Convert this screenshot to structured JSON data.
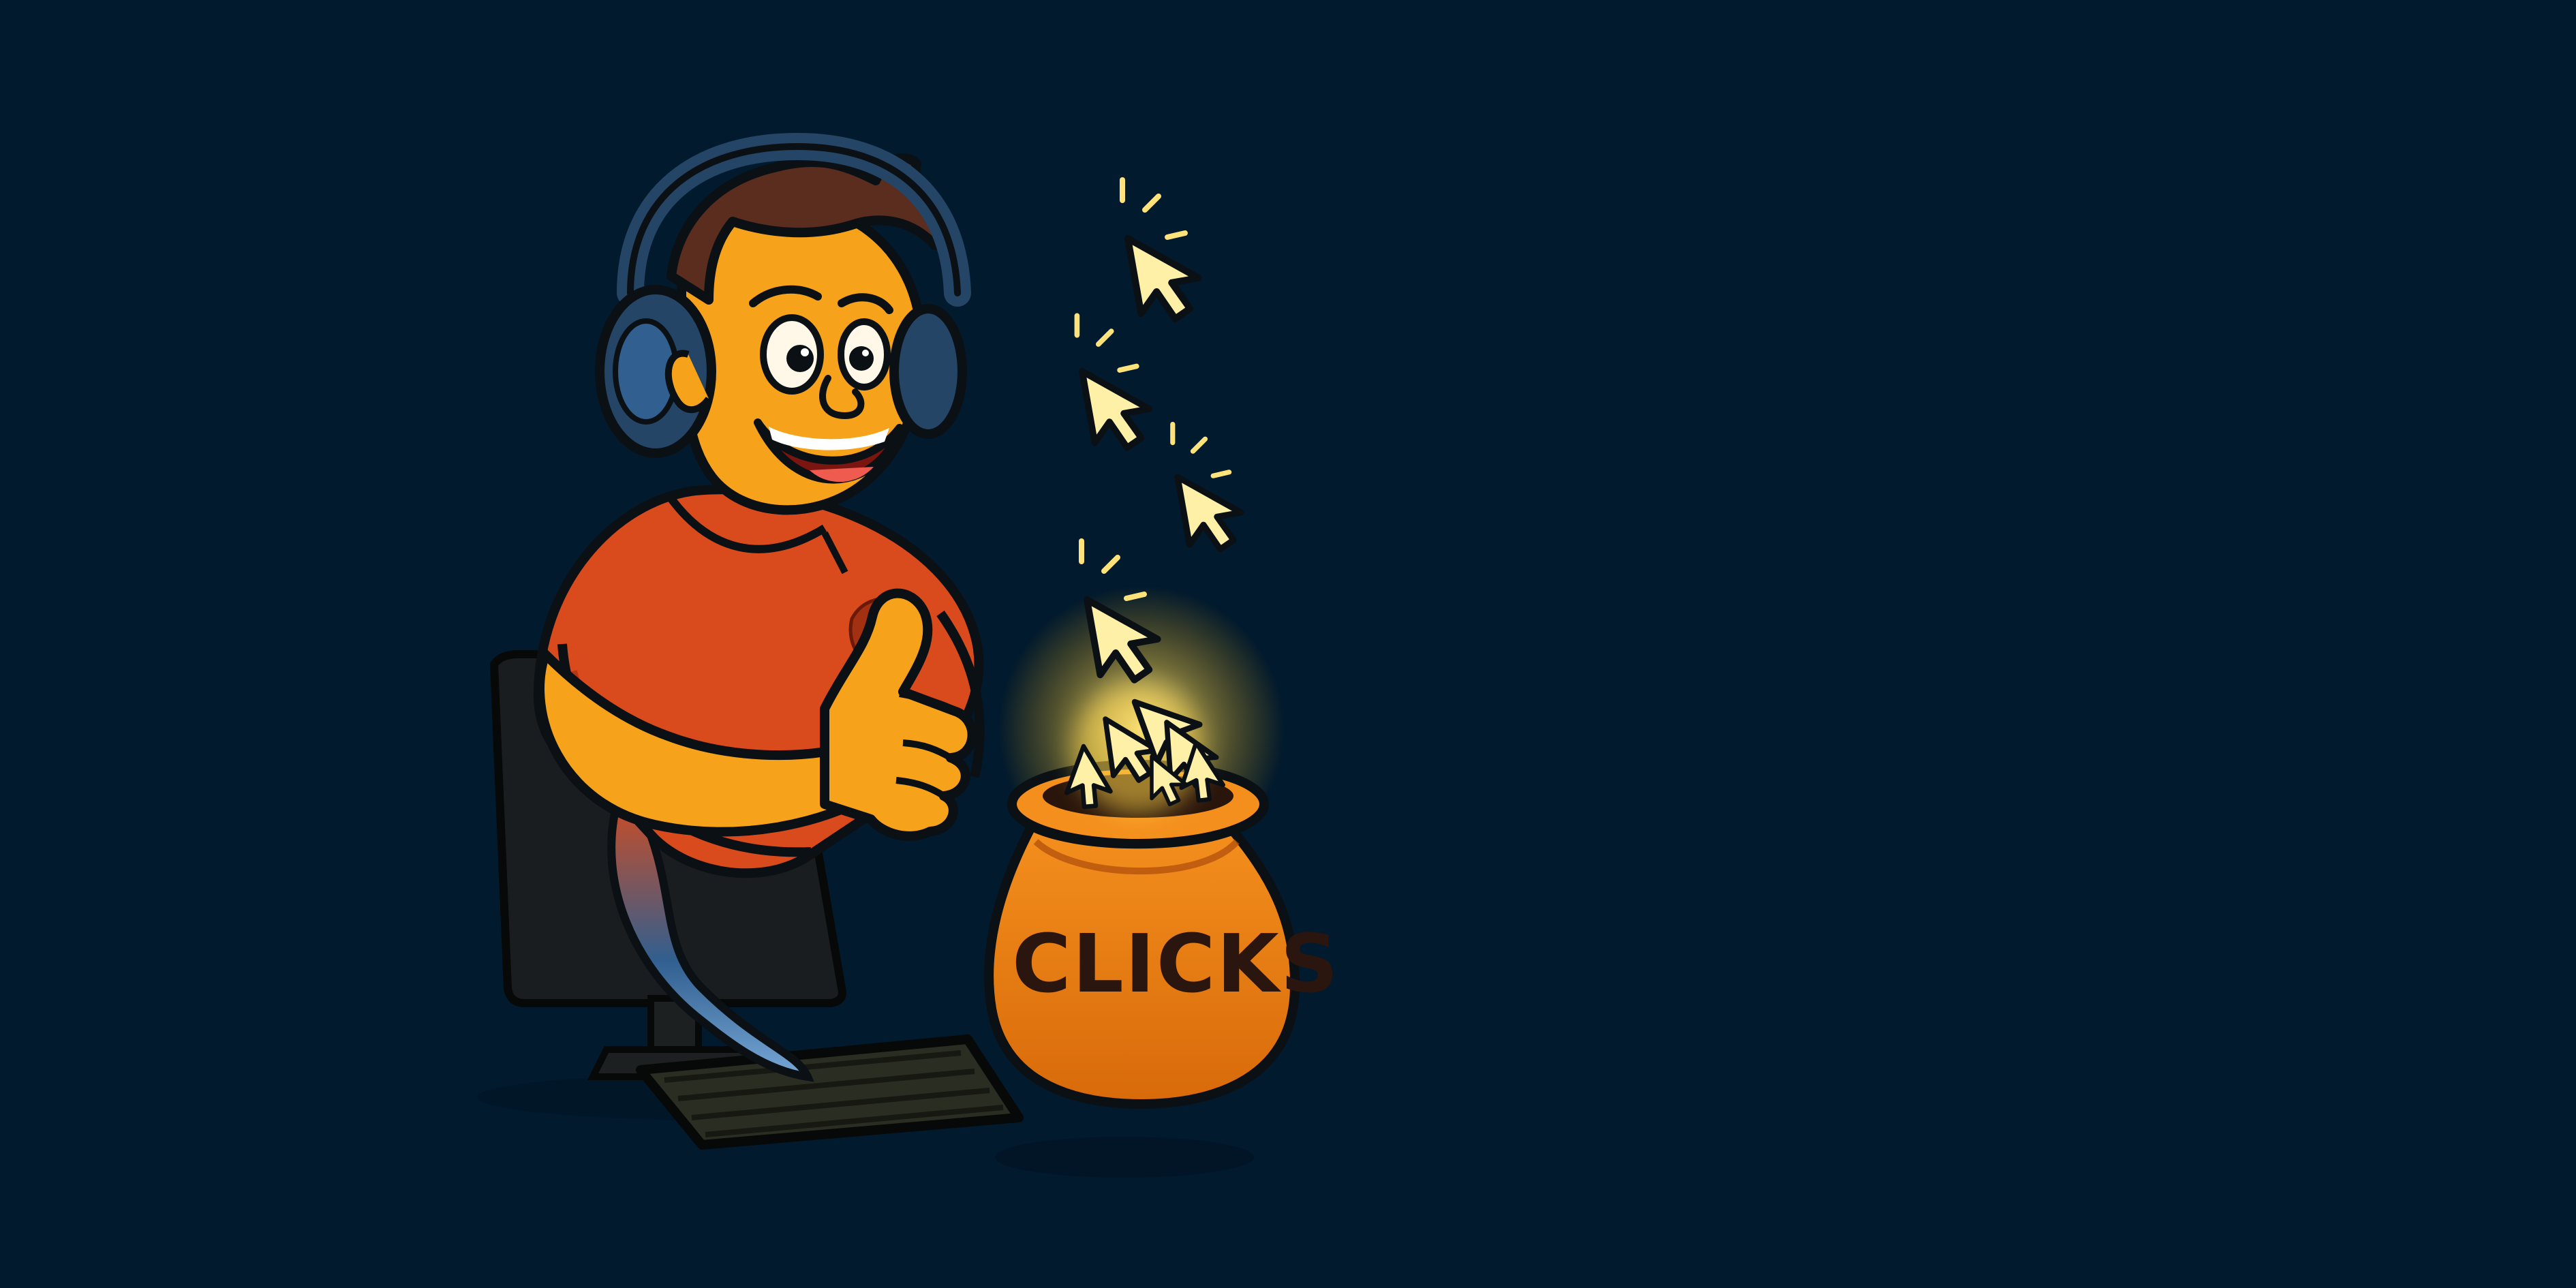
{
  "scene": {
    "background_color": "#021a2d",
    "description_labels": {
      "character": "cartoon-man-thumbs-up",
      "bag": "clicks-bag",
      "cursor_icon": "cursor-icon"
    }
  },
  "bag": {
    "label": "CLICKS"
  },
  "colors": {
    "shirt": "#d94b1c",
    "skin": "#f6a21a",
    "hair": "#5a2d1e",
    "headphones": "#244565",
    "bag": "#e9780e",
    "glow": "#ffe27a",
    "cursor": "#fff0a8",
    "monitor": "#1a1d1f",
    "keyboard": "#2a2d22"
  }
}
